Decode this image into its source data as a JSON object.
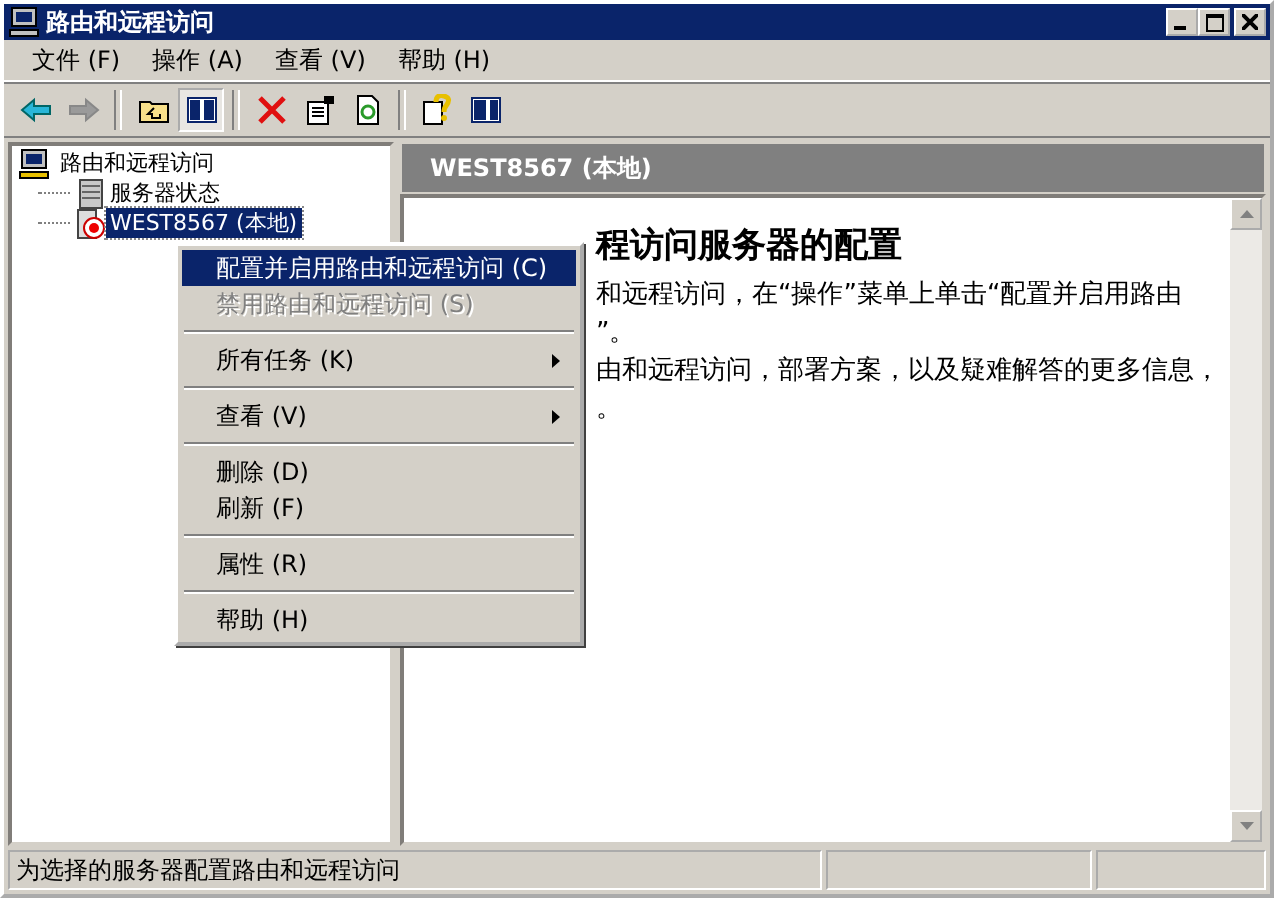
{
  "window": {
    "title": "路由和远程访问"
  },
  "menu_bar": [
    {
      "label": "文件 (F)"
    },
    {
      "label": "操作 (A)"
    },
    {
      "label": "查看 (V)"
    },
    {
      "label": "帮助 (H)"
    }
  ],
  "toolbar": [
    {
      "kind": "back",
      "disabled": false,
      "pressed": false
    },
    {
      "kind": "forward",
      "disabled": true,
      "pressed": false
    },
    {
      "kind": "separator"
    },
    {
      "kind": "up",
      "pressed": false
    },
    {
      "kind": "tree",
      "pressed": true
    },
    {
      "kind": "separator"
    },
    {
      "kind": "delete",
      "pressed": false
    },
    {
      "kind": "properties",
      "pressed": false
    },
    {
      "kind": "refresh",
      "pressed": false
    },
    {
      "kind": "separator"
    },
    {
      "kind": "help",
      "pressed": false
    },
    {
      "kind": "panel",
      "pressed": false
    }
  ],
  "tree": {
    "label": "路由和远程访问",
    "children": [
      {
        "label": "服务器状态",
        "kind": "status",
        "selected": false
      },
      {
        "label": "WEST8567 (本地)",
        "kind": "server",
        "selected": true
      }
    ]
  },
  "details": {
    "header": "WEST8567 (本地)",
    "heading": "程访问服务器的配置",
    "lines": [
      "和远程访问，在“操作”菜单上单击“配置并启用路由",
      "”。",
      "由和远程访问，部署方案，以及疑难解答的更多信息，",
      "。"
    ]
  },
  "context_menu": [
    {
      "kind": "item",
      "label": "配置并启用路由和远程访问 (C)",
      "selected": true,
      "disabled": false,
      "submenu": false
    },
    {
      "kind": "item",
      "label": "禁用路由和远程访问 (S)",
      "selected": false,
      "disabled": true,
      "submenu": false
    },
    {
      "kind": "separator"
    },
    {
      "kind": "item",
      "label": "所有任务 (K)",
      "selected": false,
      "disabled": false,
      "submenu": true
    },
    {
      "kind": "separator"
    },
    {
      "kind": "item",
      "label": "查看 (V)",
      "selected": false,
      "disabled": false,
      "submenu": true
    },
    {
      "kind": "separator"
    },
    {
      "kind": "item",
      "label": "删除 (D)",
      "selected": false,
      "disabled": false,
      "submenu": false
    },
    {
      "kind": "item",
      "label": "刷新 (F)",
      "selected": false,
      "disabled": false,
      "submenu": false
    },
    {
      "kind": "separator"
    },
    {
      "kind": "item",
      "label": "属性 (R)",
      "selected": false,
      "disabled": false,
      "submenu": false
    },
    {
      "kind": "separator"
    },
    {
      "kind": "item",
      "label": "帮助 (H)",
      "selected": false,
      "disabled": false,
      "submenu": false
    }
  ],
  "status_bar": {
    "text": "为选择的服务器配置路由和远程访问"
  }
}
